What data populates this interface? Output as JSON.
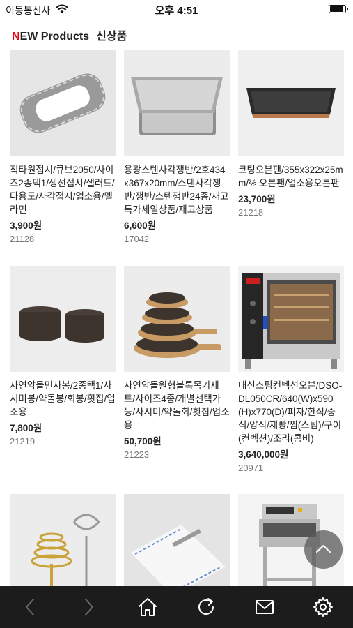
{
  "status": {
    "carrier": "이동통신사",
    "time": "오후 4:51",
    "battery_level": 0.92
  },
  "header": {
    "title_accent": "N",
    "title_rest": "EW Products",
    "title_kr": "신상품"
  },
  "products": [
    {
      "name": "직타원접시/큐브2050/사이즈2종택1/생선접시/샐러드/다용도/사각접시/업소용/멜라민",
      "price": "3,900원",
      "code": "21128"
    },
    {
      "name": "용광스텐사각쟁반/2호434x367x20mm/스텐사각쟁반/쟁반/스텐쟁반24종/재고 특가세일상품/재고상품",
      "price": "6,600원",
      "code": "17042"
    },
    {
      "name": "코팅오븐팬/355x322x25mm/⅔ 오븐팬/업소용오븐팬",
      "price": "23,700원",
      "code": "21218"
    },
    {
      "name": "자연약돌민자봉/2종택1/사시미봉/약돌봉/회봉/횟집/업소용",
      "price": "7,800원",
      "code": "21219"
    },
    {
      "name": "자연약돌원형블록목기세트/사이즈4종/개별선택가능/사시미/약돌회/횟집/업소용",
      "price": "50,700원",
      "code": "21223"
    },
    {
      "name": "대신스팀컨벡션오븐/DSO-DL050CR/640(W)x590(H)x770(D)/피자/한식/중식/양식/제빵/찜(스팀)/구이(컨벡션)/조리(콤비)",
      "price": "3,640,000원",
      "code": "20971"
    },
    {
      "name": "",
      "price": "",
      "code": ""
    },
    {
      "name": "",
      "price": "",
      "code": ""
    },
    {
      "name": "",
      "price": "",
      "code": ""
    }
  ],
  "colors": {
    "accent": "#e60012",
    "bottom_bar": "#1c1c1c",
    "thumb_bg": "#e9e9e9"
  }
}
